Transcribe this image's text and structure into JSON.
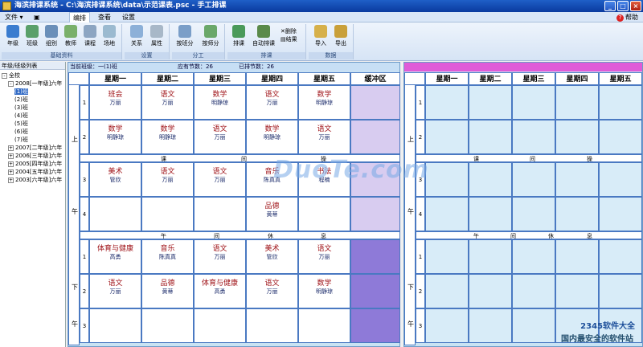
{
  "window": {
    "title": "海滨排课系统 - C:\\海滨排课系统\\data\\示范课表.psc - 手工排课"
  },
  "menu": {
    "file": "文件",
    "tabs": [
      "编排",
      "查看",
      "设置"
    ],
    "help": "帮助"
  },
  "ribbon": {
    "groups": [
      {
        "label": "基础资料",
        "buttons": [
          "年级",
          "班级",
          "组别",
          "教师",
          "课程",
          "场地"
        ]
      },
      {
        "label": "设置",
        "buttons": [
          "关系",
          "属性"
        ]
      },
      {
        "label": "分工",
        "buttons": [
          "按班分",
          "按师分"
        ]
      },
      {
        "label": "排课",
        "buttons": [
          "排课",
          "自动排课"
        ],
        "small": [
          "删除",
          "结果"
        ]
      },
      {
        "label": "数据",
        "buttons": [
          "导入",
          "导出"
        ]
      }
    ]
  },
  "left": {
    "header": "年级/班级列表",
    "tree": [
      {
        "label": "全校",
        "level": 0,
        "box": "-"
      },
      {
        "label": "2008[一年级]六年",
        "level": 1,
        "box": "-"
      },
      {
        "label": "(1)班",
        "level": 2,
        "selected": true
      },
      {
        "label": "(2)班",
        "level": 2
      },
      {
        "label": "(3)班",
        "level": 2
      },
      {
        "label": "(4)班",
        "level": 2
      },
      {
        "label": "(5)班",
        "level": 2
      },
      {
        "label": "(6)班",
        "level": 2
      },
      {
        "label": "(7)班",
        "level": 2
      },
      {
        "label": "2007[二年级]六年",
        "level": 1,
        "box": "+"
      },
      {
        "label": "2006[三年级]六年",
        "level": 1,
        "box": "+"
      },
      {
        "label": "2005[四年级]六年",
        "level": 1,
        "box": "+"
      },
      {
        "label": "2004[五年级]六年",
        "level": 1,
        "box": "+"
      },
      {
        "label": "2003[六年级]六年",
        "level": 1,
        "box": "+"
      }
    ]
  },
  "info": {
    "current_class": "当前班级：一(1)班",
    "required": "应有节数：26",
    "scheduled": "已排节数：26"
  },
  "days": [
    "星期一",
    "星期二",
    "星期三",
    "星期四",
    "星期五"
  ],
  "buffer_label": "缓冲区",
  "half_labels": {
    "am_top": "上",
    "am_bottom": "午",
    "pm_top": "下",
    "pm_bottom": "午"
  },
  "break_band": [
    "课",
    "间",
    "操"
  ],
  "noon_band": [
    "午",
    "间",
    "休",
    "息"
  ],
  "schedule": {
    "morning": [
      {
        "period": "1",
        "cells": [
          [
            "班会",
            "万丽"
          ],
          [
            "语文",
            "万丽"
          ],
          [
            "数学",
            "明静琼"
          ],
          [
            "语文",
            "万丽"
          ],
          [
            "数学",
            "明静琼"
          ]
        ]
      },
      {
        "period": "2",
        "cells": [
          [
            "数学",
            "明静琼"
          ],
          [
            "数学",
            "明静琼"
          ],
          [
            "语文",
            "万丽"
          ],
          [
            "数学",
            "明静琼"
          ],
          [
            "语文",
            "万丽"
          ]
        ]
      },
      {
        "period": "3",
        "cells": [
          [
            "美术",
            "管欣"
          ],
          [
            "语文",
            "万丽"
          ],
          [
            "语文",
            "万丽"
          ],
          [
            "音乐",
            "陈真真"
          ],
          [
            "书法",
            "程楠"
          ]
        ]
      },
      {
        "period": "4",
        "cells": [
          [
            "",
            ""
          ],
          [
            "",
            ""
          ],
          [
            "",
            ""
          ],
          [
            "品德",
            "黄蒂"
          ],
          [
            "",
            ""
          ]
        ]
      }
    ],
    "afternoon": [
      {
        "period": "1",
        "cells": [
          [
            "体育与健康",
            "高勇"
          ],
          [
            "音乐",
            "陈真真"
          ],
          [
            "语文",
            "万丽"
          ],
          [
            "美术",
            "管欣"
          ],
          [
            "语文",
            "万丽"
          ]
        ]
      },
      {
        "period": "2",
        "cells": [
          [
            "语文",
            "万丽"
          ],
          [
            "品德",
            "黄蒂"
          ],
          [
            "体育与健康",
            "高勇"
          ],
          [
            "语文",
            "万丽"
          ],
          [
            "数学",
            "明静琼"
          ]
        ]
      },
      {
        "period": "3",
        "cells": [
          [
            "",
            ""
          ],
          [
            "",
            ""
          ],
          [
            "",
            ""
          ],
          [
            "",
            ""
          ],
          [
            "",
            ""
          ]
        ]
      }
    ]
  },
  "watermark": {
    "brand": "DuoTe.com",
    "site": "2345软件大全",
    "slogan": "国内最安全的软件站"
  }
}
